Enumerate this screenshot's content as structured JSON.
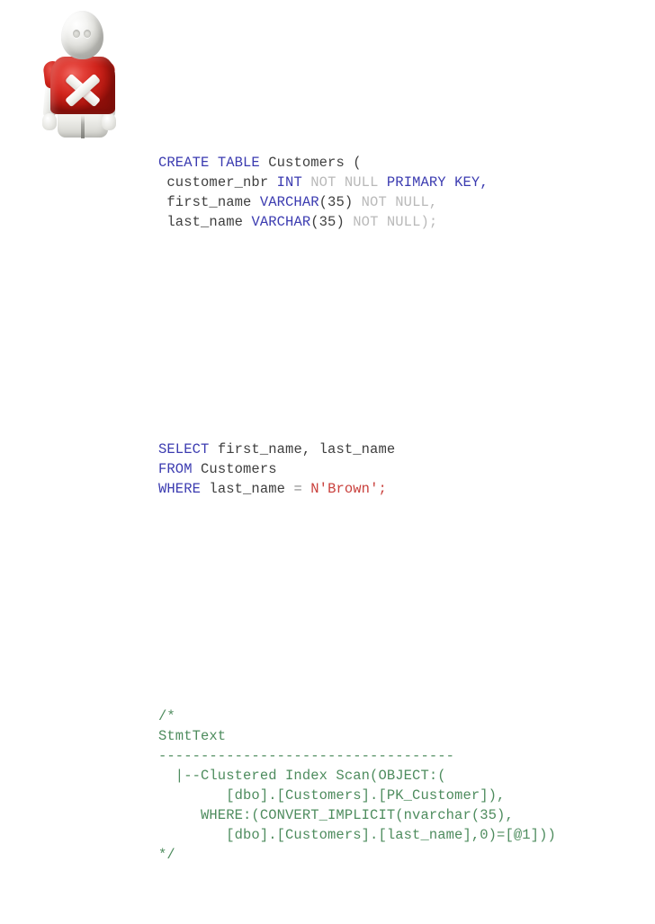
{
  "slide": {
    "background_color": "#ffffff",
    "mascot": {
      "name": "red-x-shirt-figure",
      "shirt_color": "#d0241c",
      "body_color": "#ededea",
      "emblem": "x-mark"
    }
  },
  "colors": {
    "keyword": "#3b3bb0",
    "identifier": "#3f3f3f",
    "dim_keyword": "#b9b9b9",
    "string_literal": "#c9403c",
    "comment": "#4e8c5e",
    "operator": "#8a8a8a"
  },
  "code": {
    "create_block": {
      "line1": {
        "kw_create": "CREATE",
        "sp1": " ",
        "kw_table": "TABLE",
        "sp2": " ",
        "id_customers": "Customers",
        "paren": " ("
      },
      "line2": {
        "indent": " ",
        "col_name": "customer_nbr",
        "sp1": " ",
        "kw_int": "INT",
        "sp2": " ",
        "dim_notnull": "NOT NULL",
        "sp3": " ",
        "kw_pk": "PRIMARY KEY",
        "comma": ","
      },
      "line3": {
        "indent": " ",
        "col_name": "first_name",
        "sp1": " ",
        "kw_varchar": "VARCHAR",
        "size": "(35)",
        "sp2": " ",
        "dim_notnull": "NOT NULL,"
      },
      "line4": {
        "indent": " ",
        "col_name": "last_name",
        "sp1": " ",
        "kw_varchar": "VARCHAR",
        "size": "(35)",
        "sp2": " ",
        "dim_notnull": "NOT NULL);"
      }
    },
    "select_block": {
      "line1": {
        "kw_select": "SELECT",
        "sp": " ",
        "columns": "first_name, last_name"
      },
      "line2": {
        "kw_from": "FROM",
        "sp": " ",
        "table": "Customers"
      },
      "line3": {
        "kw_where": "WHERE",
        "sp1": " ",
        "column": "last_name",
        "sp2": " ",
        "op_eq": "=",
        "sp3": " ",
        "literal": "N'Brown';"
      }
    },
    "comment_block": {
      "open": "/*",
      "header": "StmtText",
      "separator": "-----------------------------------",
      "plan_line1": "  |--Clustered Index Scan(OBJECT:(",
      "plan_line2": "        [dbo].[Customers].[PK_Customer]),",
      "plan_line3": "     WHERE:(CONVERT_IMPLICIT(nvarchar(35),",
      "plan_line4": "        [dbo].[Customers].[last_name],0)=[@1]))",
      "close": "*/"
    }
  }
}
